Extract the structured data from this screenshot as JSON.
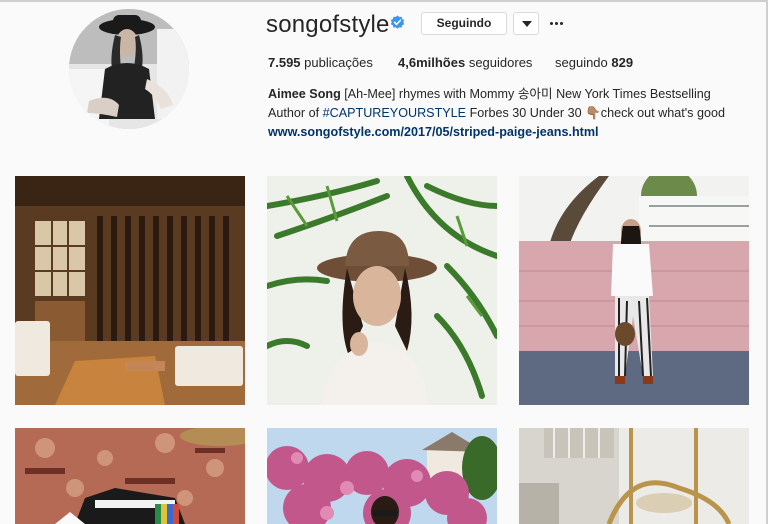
{
  "profile": {
    "username": "songofstyle",
    "verified": true,
    "follow_button": "Seguindo",
    "stats": {
      "posts_count": "7.595",
      "posts_label": "publicações",
      "followers_count": "4,6milhões",
      "followers_label": "seguidores",
      "following_label": "seguindo",
      "following_count": "829"
    },
    "bio": {
      "name": "Aimee Song",
      "line1_rest": "[Ah-Mee] rhymes with Mommy 송아미 New York Times Bestselling",
      "line2_prefix": "Author of",
      "hashtag": "#CAPTUREYOURSTYLE",
      "line2_suffix": "Forbes 30 Under 30 👇🏽check out what's good",
      "website": "www.songofstyle.com/2017/05/striped-paige-jeans.html"
    }
  },
  "posts": [
    {
      "name": "post-interior-room"
    },
    {
      "name": "post-hat-palm-portrait"
    },
    {
      "name": "post-striped-pants-outfit"
    },
    {
      "name": "post-rug-shoes"
    },
    {
      "name": "post-bougainvillea"
    },
    {
      "name": "post-mirror-decor"
    }
  ],
  "colors": {
    "text": "#262626",
    "link": "#003569",
    "verified_badge": "#3897f0",
    "border": "#dbdbdb",
    "background": "#fafafa"
  },
  "icons": [
    "verified-badge-icon",
    "chevron-down-icon",
    "more-options-icon"
  ]
}
